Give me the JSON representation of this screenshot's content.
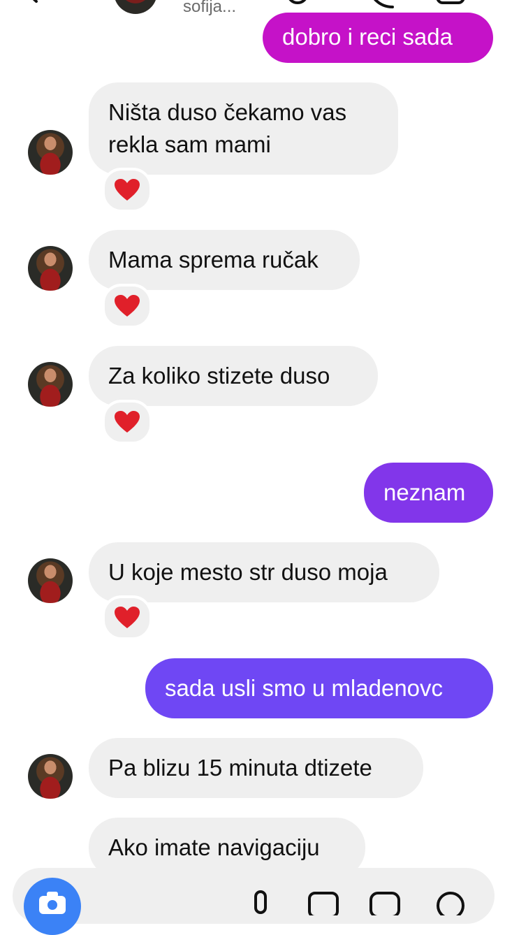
{
  "header": {
    "contact_name": "sofija...",
    "icons": [
      "back-icon",
      "video-call-icon",
      "phone-call-icon",
      "more-icon"
    ]
  },
  "colors": {
    "incoming_bubble": "#efefef",
    "outgoing_magenta": "#c512c8",
    "outgoing_purple_a": "#8236ea",
    "outgoing_purple_b": "#6f47f4",
    "camera_button": "#3b82f6",
    "heart": "#e0202a"
  },
  "messages": [
    {
      "direction": "outgoing",
      "text": "dobro i reci sada"
    },
    {
      "direction": "incoming",
      "lines": [
        "Ništa duso čekamo vas",
        "rekla sam mami"
      ],
      "reaction": "heart-emoji"
    },
    {
      "direction": "incoming",
      "text": "Mama sprema ručak",
      "reaction": "heart-emoji"
    },
    {
      "direction": "incoming",
      "text": "Za koliko stizete duso",
      "reaction": "heart-emoji"
    },
    {
      "direction": "outgoing",
      "text": "neznam"
    },
    {
      "direction": "incoming",
      "text": "U koje mesto str duso moja",
      "reaction": "heart-emoji"
    },
    {
      "direction": "outgoing",
      "text": "sada usli smo u mladenovc"
    },
    {
      "direction": "incoming",
      "text": "Pa blizu 15 minuta dtizete"
    },
    {
      "direction": "incoming",
      "text": "Ako imate navigaciju"
    }
  ],
  "composer": {
    "placeholder": "",
    "icons": [
      "camera-icon",
      "microphone-icon",
      "gallery-icon",
      "sticker-icon",
      "add-icon"
    ]
  }
}
